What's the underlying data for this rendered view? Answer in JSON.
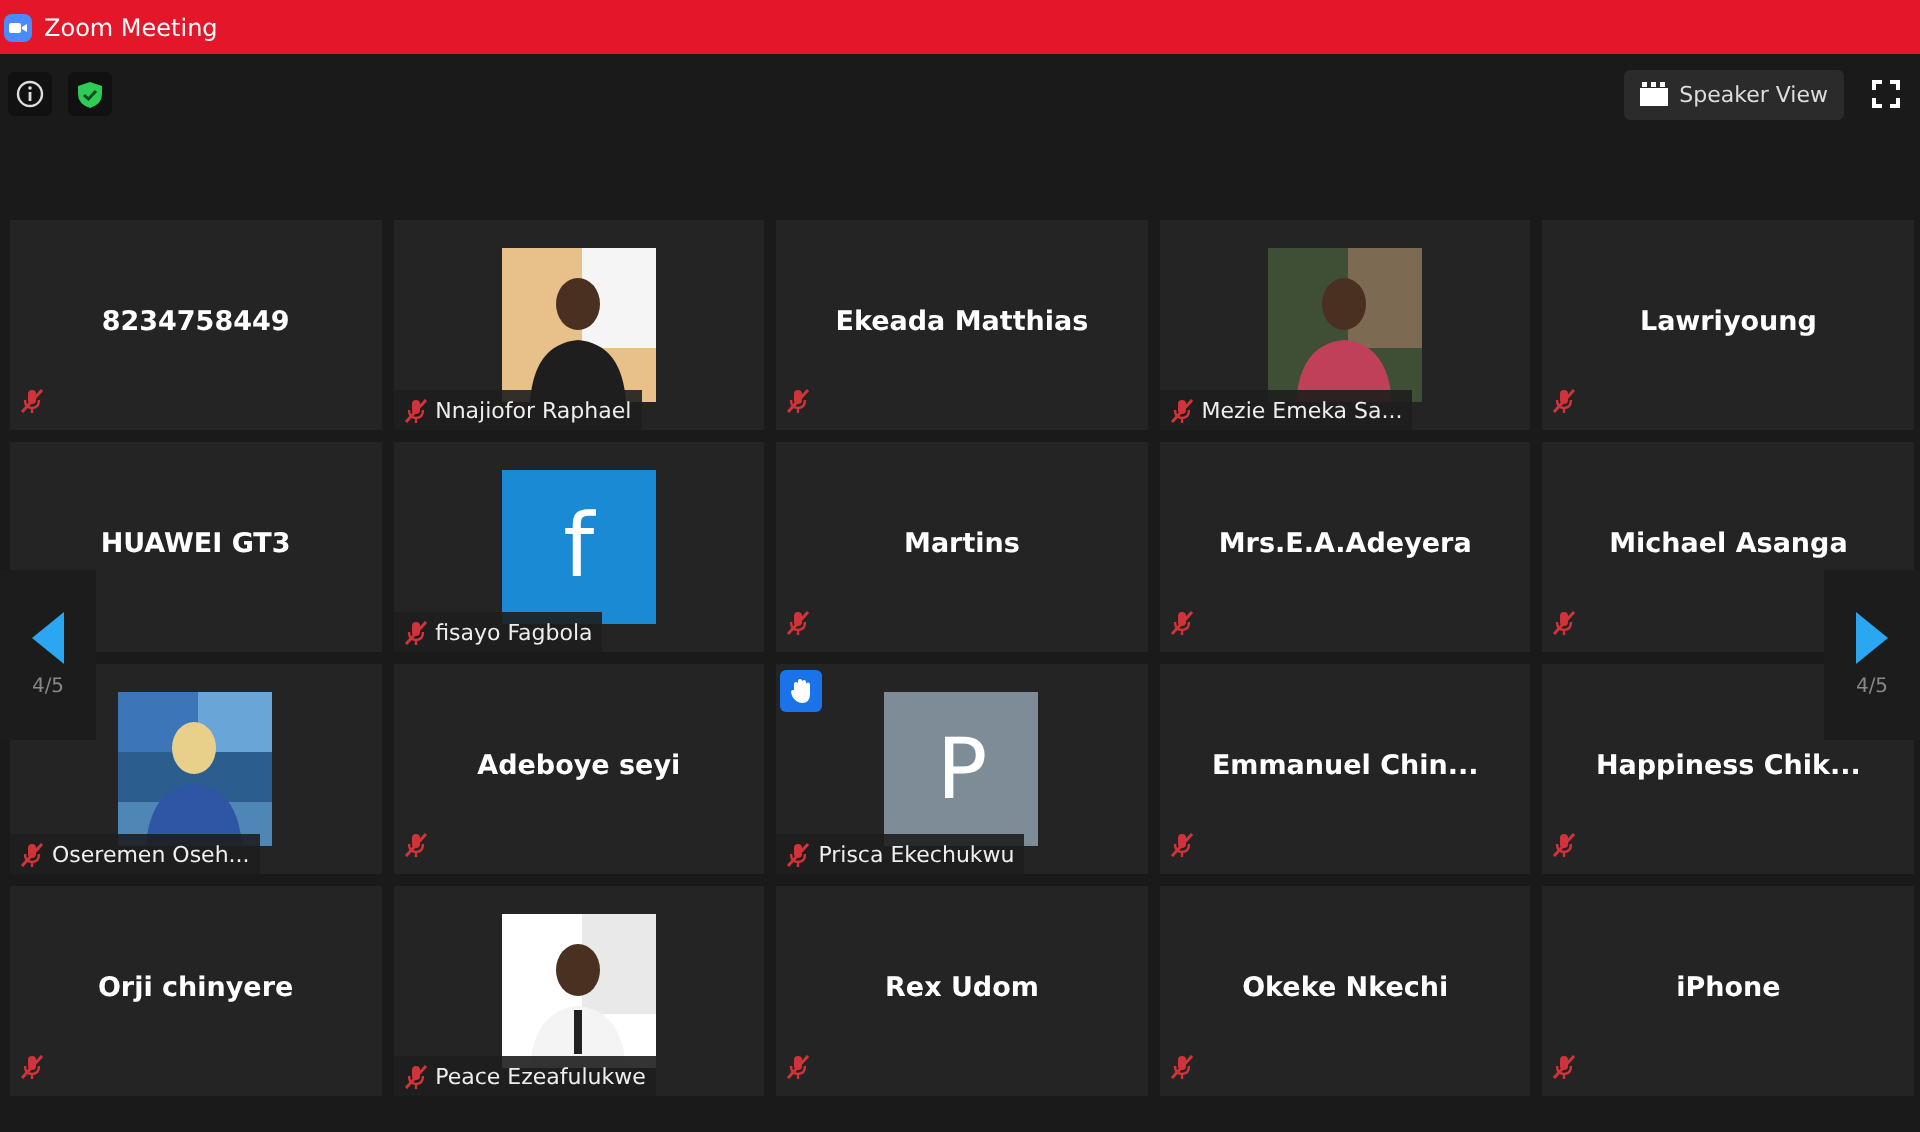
{
  "window": {
    "title": "Zoom Meeting"
  },
  "toolbar": {
    "view_button": "Speaker View"
  },
  "pager": {
    "left": "4/5",
    "right": "4/5"
  },
  "tiles": [
    {
      "kind": "name",
      "name": "8234758449",
      "muted": true,
      "hand_raised": false
    },
    {
      "name": "Nnajiofor Raphael",
      "muted": true,
      "hand_raised": false
    },
    {
      "kind": "name",
      "name": "Ekeada Matthias",
      "muted": true,
      "hand_raised": false
    },
    {
      "name": "Mezie Emeka Sa...",
      "muted": true,
      "hand_raised": false
    },
    {
      "kind": "name",
      "name": "Lawriyoung",
      "muted": true,
      "hand_raised": false
    },
    {
      "kind": "name",
      "name": "HUAWEI GT3",
      "muted": false,
      "hand_raised": false
    },
    {
      "kind": "logo",
      "avatar": "f",
      "name": "fisayo Fagbola",
      "muted": true,
      "hand_raised": false
    },
    {
      "kind": "name",
      "name": "Martins",
      "muted": true,
      "hand_raised": false
    },
    {
      "kind": "name",
      "name": "Mrs.E.A.Adeyera",
      "muted": true,
      "hand_raised": false
    },
    {
      "kind": "name",
      "name": "Michael Asanga",
      "muted": true,
      "hand_raised": false
    },
    {
      "name": "Oseremen Oseh...",
      "muted": true,
      "hand_raised": false
    },
    {
      "kind": "name",
      "name": "Adeboye seyi",
      "muted": true,
      "hand_raised": false
    },
    {
      "kind": "letter",
      "avatar": "P",
      "name": "Prisca Ekechukwu",
      "muted": true,
      "hand_raised": true
    },
    {
      "kind": "name",
      "name": "Emmanuel  Chin...",
      "muted": true,
      "hand_raised": false
    },
    {
      "kind": "name",
      "name": "Happiness  Chik...",
      "muted": true,
      "hand_raised": false
    },
    {
      "kind": "name",
      "name": "Orji chinyere",
      "muted": true,
      "hand_raised": false
    },
    {
      "name": "Peace Ezeafulukwe",
      "muted": true,
      "hand_raised": false
    },
    {
      "kind": "name",
      "name": "Rex Udom",
      "muted": true,
      "hand_raised": false
    },
    {
      "kind": "name",
      "name": "Okeke Nkechi",
      "muted": true,
      "hand_raised": false
    },
    {
      "kind": "name",
      "name": "iPhone",
      "muted": true,
      "hand_raised": false
    }
  ]
}
